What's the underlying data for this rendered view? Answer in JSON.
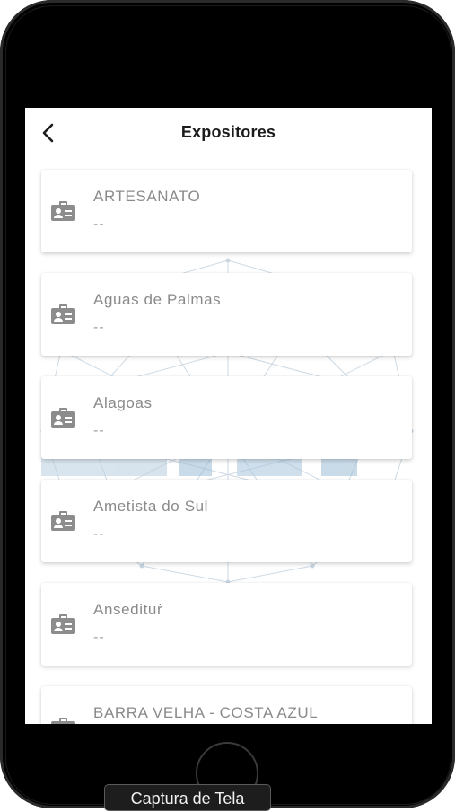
{
  "header": {
    "title": "Expositores",
    "back_icon": "chevron-left-icon"
  },
  "exhibitors": [
    {
      "name": "ARTESANATO",
      "detail": "--"
    },
    {
      "name": "Aguas de Palmas",
      "detail": "--"
    },
    {
      "name": "Alagoas",
      "detail": "--"
    },
    {
      "name": "Ametista do Sul",
      "detail": "--"
    },
    {
      "name": "Ansedituṙ",
      "detail": "--"
    },
    {
      "name": "BARRA VELHA - COSTA AZUL",
      "detail": ""
    }
  ],
  "card_icon": "id-badge-icon",
  "overlay": {
    "caption": "Captura de Tela"
  },
  "colors": {
    "accent_text": "#8a8a8a",
    "icon": "#8c8c8c",
    "network": "#c8d6e2"
  }
}
